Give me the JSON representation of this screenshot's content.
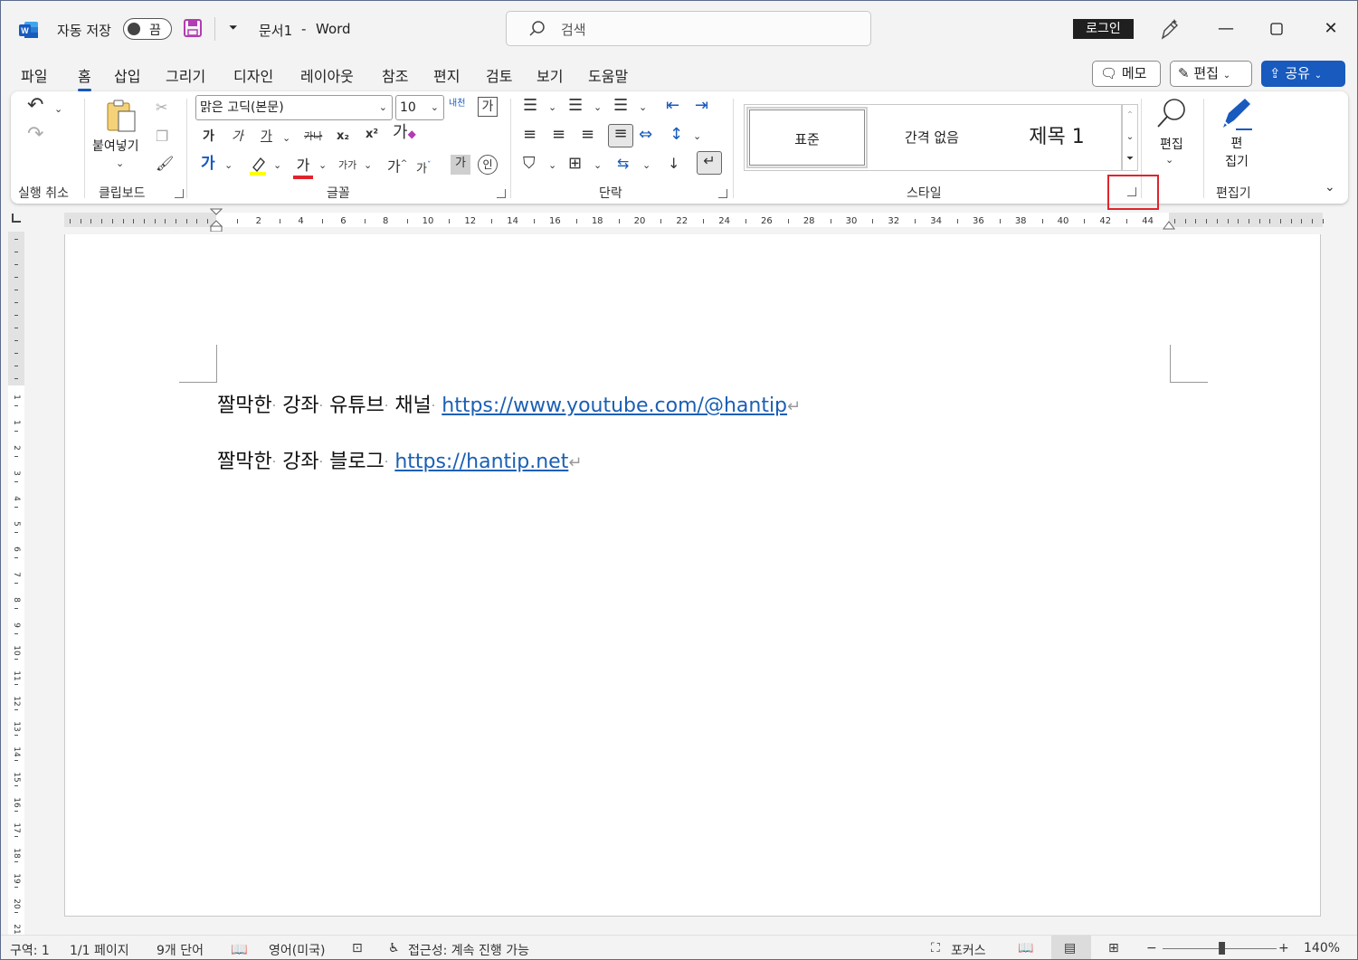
{
  "titlebar": {
    "autosave_label": "자동 저장",
    "autosave_state": "끔",
    "doc_title": "문서1",
    "separator": "-",
    "app_name": "Word",
    "search_placeholder": "검색",
    "login_label": "로그인"
  },
  "tabs": [
    "파일",
    "홈",
    "삽입",
    "그리기",
    "디자인",
    "레이아웃",
    "참조",
    "편지",
    "검토",
    "보기",
    "도움말"
  ],
  "tab_buttons": {
    "memo": "메모",
    "edit": "편집",
    "share": "공유"
  },
  "ribbon": {
    "undo_group_label": "실행 취소",
    "clipboard": {
      "paste_label": "붙여넣기",
      "group_label": "클립보드"
    },
    "font": {
      "font_name": "맑은 고딕(본문)",
      "font_size": "10",
      "bold": "가",
      "italic": "가",
      "underline": "가",
      "strike": "가나",
      "sub": "x₂",
      "sup": "x²",
      "grow": "가",
      "shrink": "가",
      "case": "가가",
      "group_label": "글꼴"
    },
    "paragraph": {
      "group_label": "단락"
    },
    "styles": {
      "items": [
        "표준",
        "간격 없음",
        "제목 1"
      ],
      "group_label": "스타일"
    },
    "editing": {
      "find_label": "편집",
      "editor_label": "편\n집기",
      "group_label": "편집기"
    },
    "accent_color": "#185abd",
    "highlight_box_color": "#e0242c"
  },
  "ruler": {
    "numbers": [
      "2",
      "4",
      "6",
      "8",
      "10",
      "12",
      "14",
      "16",
      "18",
      "20",
      "22",
      "24",
      "26",
      "28",
      "30",
      "32",
      "34",
      "36",
      "38",
      "40",
      "42",
      "44"
    ]
  },
  "vruler": {
    "numbers": [
      "1",
      "1",
      "2",
      "3",
      "4",
      "5",
      "6",
      "7",
      "8",
      "9",
      "10",
      "11",
      "12",
      "13",
      "14",
      "15",
      "16",
      "17",
      "18",
      "19",
      "20",
      "21"
    ]
  },
  "document": {
    "paragraphs": [
      {
        "words": [
          "짤막한",
          "강좌",
          "유튜브",
          "채널"
        ],
        "link": "https://www.youtube.com/@hantip"
      },
      {
        "words": [
          "짤막한",
          "강좌",
          "블로그"
        ],
        "link": "https://hantip.net"
      }
    ]
  },
  "statusbar": {
    "section": "구역: 1",
    "page": "1/1 페이지",
    "words": "9개 단어",
    "language": "영어(미국)",
    "accessibility": "접근성: 계속 진행 가능",
    "focus": "포커스",
    "zoom": "140%"
  }
}
